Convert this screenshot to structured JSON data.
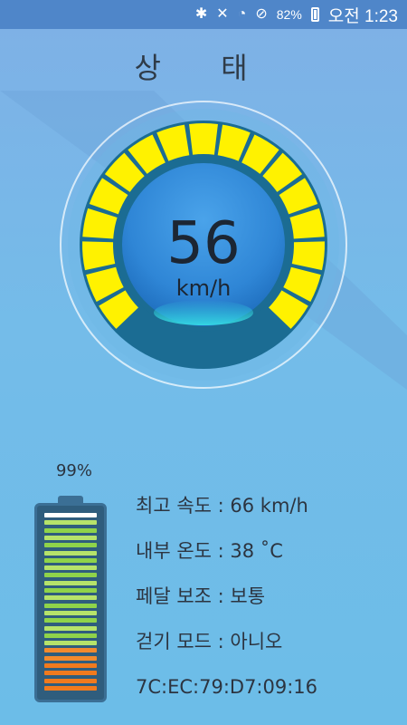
{
  "status_bar": {
    "icons": [
      "bluetooth-icon",
      "mute-icon",
      "wifi-icon",
      "do-not-disturb-icon"
    ],
    "battery_text": "82%",
    "time": "오전 1:23"
  },
  "title": "상 태",
  "speedometer": {
    "value": "56",
    "unit": "km/h",
    "accent_color": "#fff200",
    "track_color": "#1b6c93",
    "center_color": "#3a8fdc"
  },
  "battery": {
    "percent_text": "99%",
    "level": 0.99
  },
  "info": {
    "max_speed": "최고 속도 : 66 km/h",
    "internal_temp": "내부 온도 : 38 ˚C",
    "pedal_assist": "페달 보조 : 보통",
    "walk_mode": "걷기 모드 : 아니오",
    "mac_address": "7C:EC:79:D7:09:16"
  }
}
